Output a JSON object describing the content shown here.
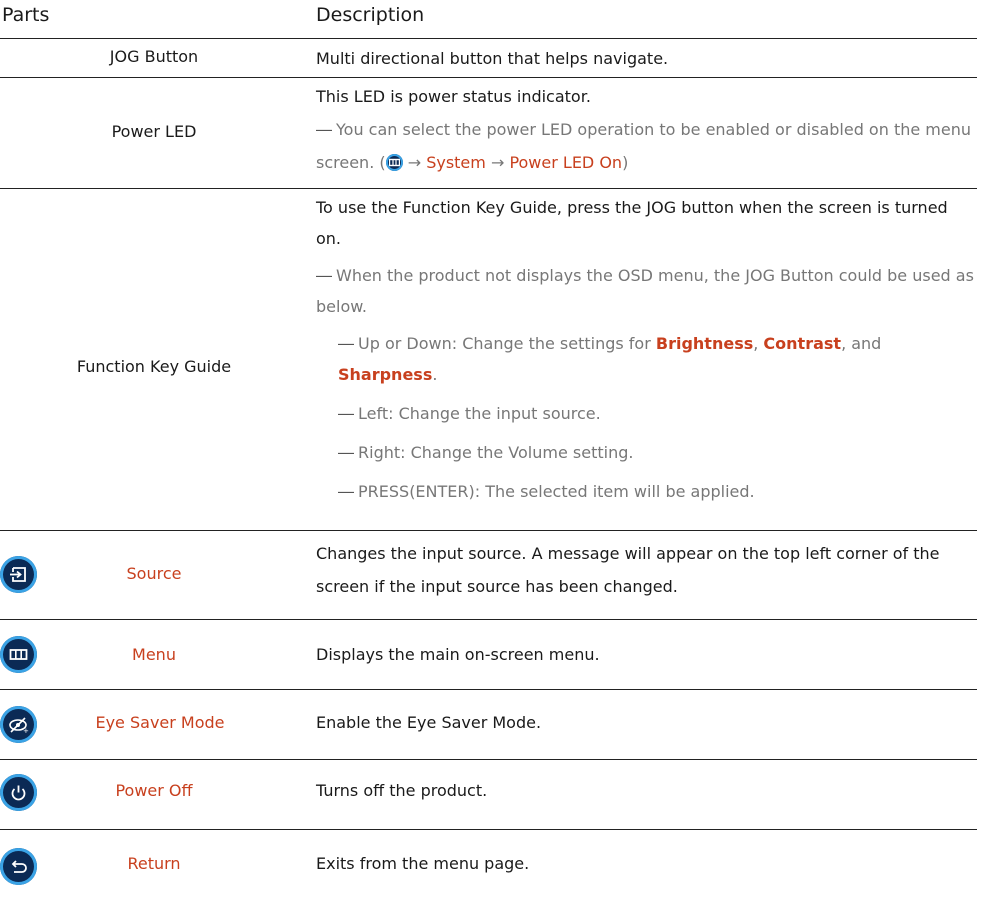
{
  "header": {
    "parts": "Parts",
    "description": "Description"
  },
  "rows": {
    "jog": {
      "part": "JOG Button",
      "desc": "Multi directional button that helps navigate."
    },
    "power_led": {
      "part": "Power LED",
      "desc": "This LED is power status indicator.",
      "note_text": "You can select the power LED operation to be enabled or disabled on the menu screen. (",
      "arrow1": " → ",
      "system": "System",
      "arrow2": " → ",
      "power_led_on": "Power LED On",
      "close": ")"
    },
    "function_key": {
      "part": "Function Key Guide",
      "desc": "To use the Function Key Guide, press the JOG button when the screen is turned on.",
      "note1": "When the product not displays the OSD menu, the JOG Button could be used as below.",
      "note2_pre": "Up or Down: Change the settings for ",
      "brightness": "Brightness",
      "comma": ", ",
      "contrast": "Contrast",
      "and": ", and",
      "sharpness": "Sharpness",
      "period": ".",
      "note3": "Left: Change the input source.",
      "note4": "Right: Change the Volume setting.",
      "note5": "PRESS(ENTER): The selected item will be applied."
    },
    "source": {
      "part": "Source",
      "icon": "source-icon",
      "desc": "Changes the input source. A message will appear on the top left corner of the screen if the input source has been changed."
    },
    "menu": {
      "part": "Menu",
      "icon": "menu-icon",
      "desc": "Displays the main on-screen menu."
    },
    "eye_saver": {
      "part": "Eye Saver Mode",
      "icon": "eye-saver-icon",
      "desc": "Enable the Eye Saver Mode."
    },
    "power_off": {
      "part": "Power Off",
      "icon": "power-icon",
      "desc": "Turns off the product."
    },
    "return": {
      "part": "Return",
      "icon": "return-icon",
      "desc": "Exits from the menu page."
    }
  },
  "note_dash": "―",
  "colors": {
    "accent": "#c8401e",
    "icon_fill": "#0b2a55",
    "icon_ring": "#3aa3e6",
    "rule": "#222222",
    "note_text": "#777777"
  }
}
